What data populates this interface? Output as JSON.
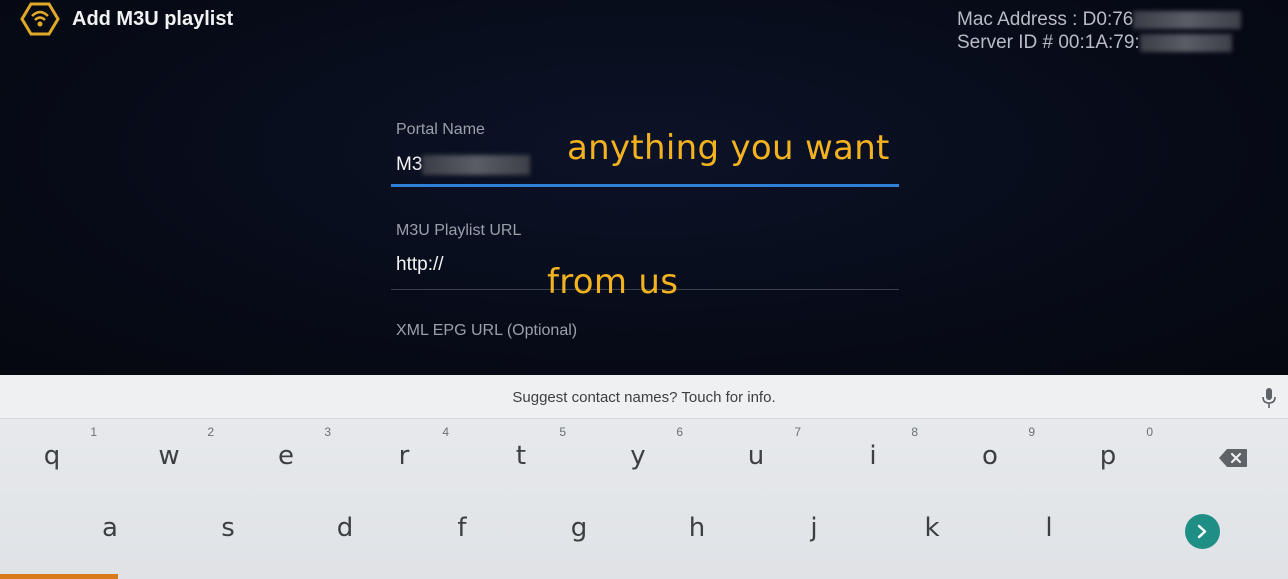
{
  "header": {
    "logo_icon": "hexagon-signal-logo-icon",
    "title": "Add M3U playlist",
    "mac_address_label": "Mac Address : D0:76",
    "server_id_label": "Server ID # 00:1A:79:"
  },
  "form": {
    "portal_name": {
      "label": "Portal Name",
      "value": "M3"
    },
    "playlist_url": {
      "label": "M3U Playlist URL",
      "value": "http://"
    },
    "epg_url": {
      "label": "XML EPG URL (Optional)"
    }
  },
  "annotations": {
    "portal_hint": "anything you want",
    "url_hint": "from us"
  },
  "keyboard": {
    "suggestion": "Suggest contact names? Touch for info.",
    "row1": [
      {
        "key": "q",
        "hint": "1"
      },
      {
        "key": "w",
        "hint": "2"
      },
      {
        "key": "e",
        "hint": "3"
      },
      {
        "key": "r",
        "hint": "4"
      },
      {
        "key": "t",
        "hint": "5"
      },
      {
        "key": "y",
        "hint": "6"
      },
      {
        "key": "u",
        "hint": "7"
      },
      {
        "key": "i",
        "hint": "8"
      },
      {
        "key": "o",
        "hint": "9"
      },
      {
        "key": "p",
        "hint": "0"
      }
    ],
    "row2": [
      {
        "key": "a"
      },
      {
        "key": "s"
      },
      {
        "key": "d"
      },
      {
        "key": "f"
      },
      {
        "key": "g"
      },
      {
        "key": "h"
      },
      {
        "key": "j"
      },
      {
        "key": "k"
      },
      {
        "key": "l"
      }
    ],
    "icons": {
      "mic": "microphone-icon",
      "backspace": "backspace-icon",
      "enter": "chevron-right-icon"
    }
  },
  "colors": {
    "accent_underline": "#2f7fd6",
    "annotation_text": "#f5b21f",
    "enter_key": "#1f8f86",
    "logo": "#e0a92a"
  }
}
